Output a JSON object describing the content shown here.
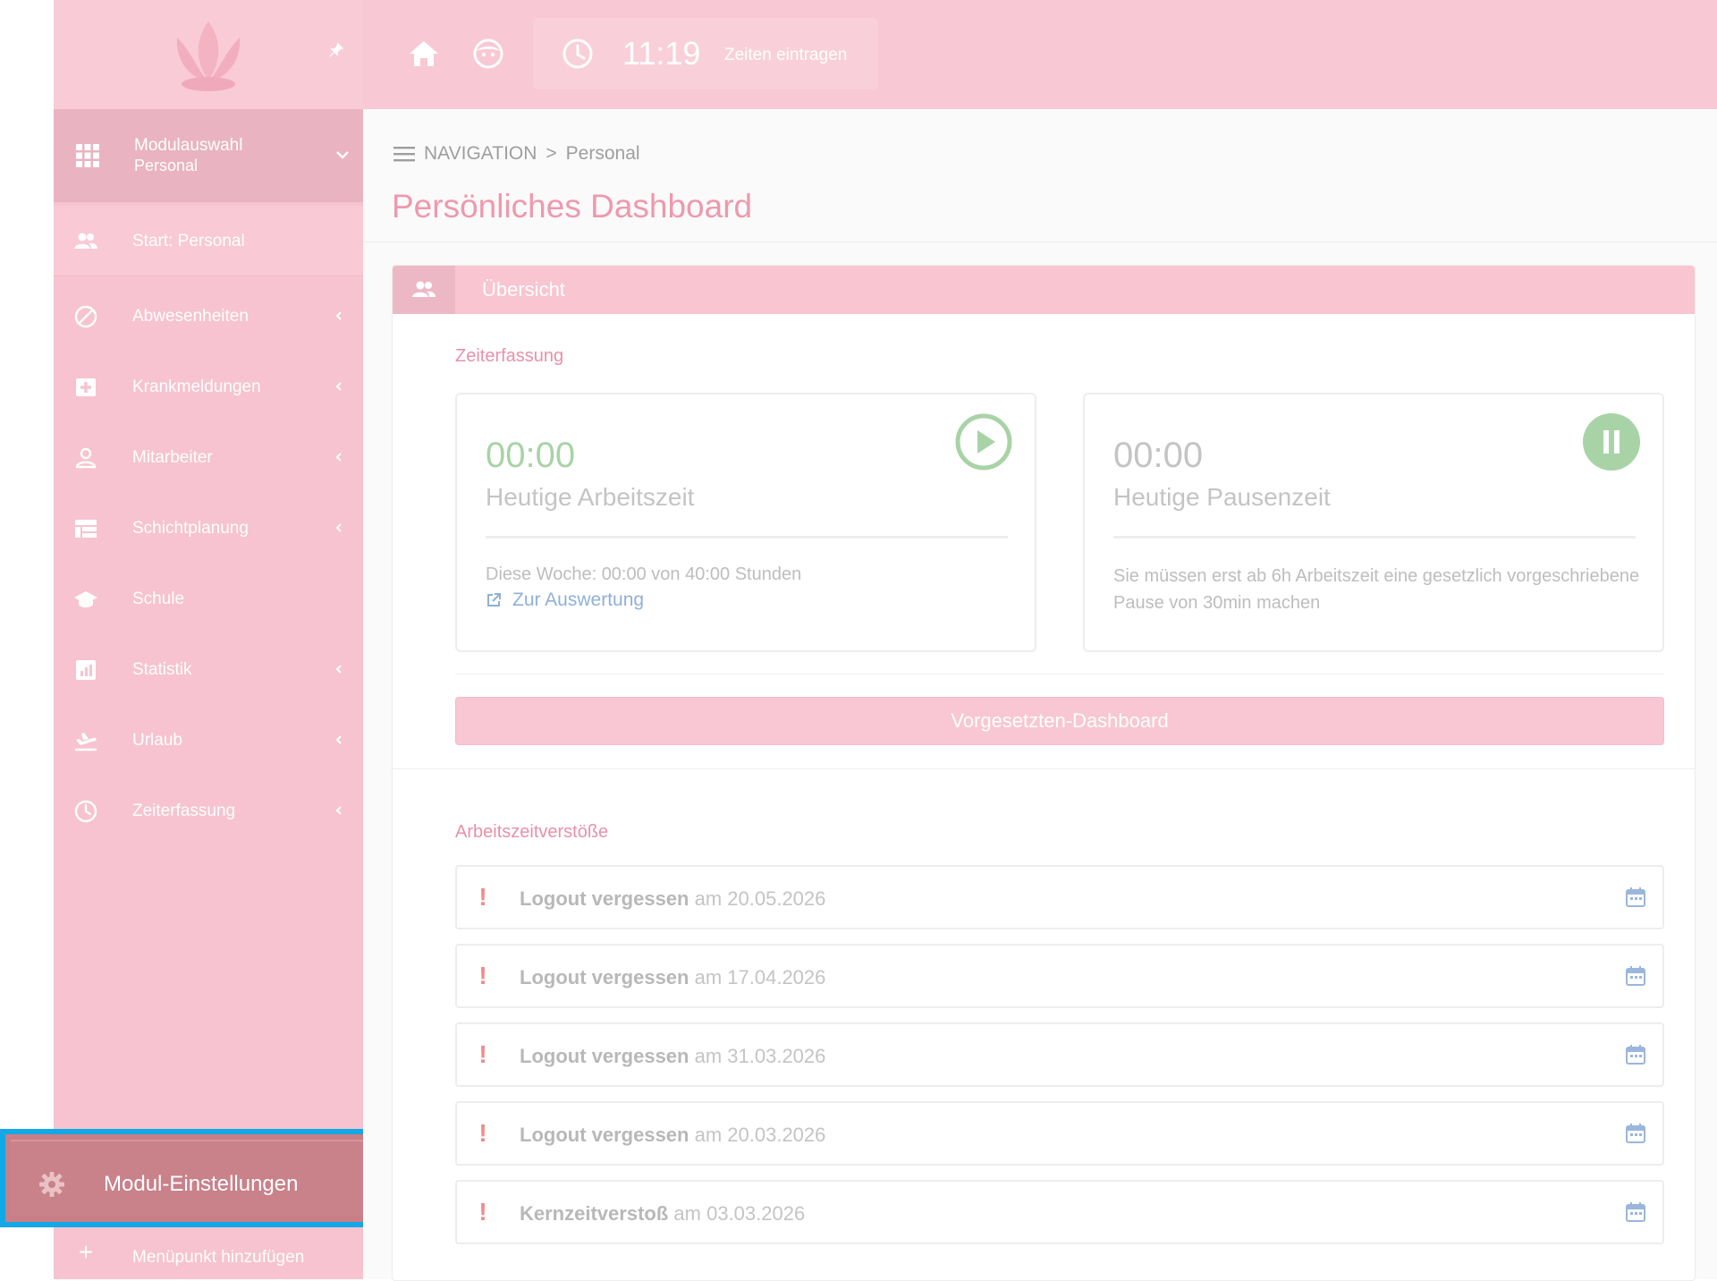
{
  "header": {
    "clock_time": "11:19",
    "clock_label": "Zeiten eintragen",
    "icons": [
      "lotus-logo",
      "pin-icon",
      "home-icon",
      "face-icon",
      "clock-icon"
    ]
  },
  "sidebar": {
    "module_title": "Modulauswahl",
    "module_sub": "Personal",
    "start_label": "Start: Personal",
    "items": [
      {
        "label": "Abwesenheiten",
        "icon": "ban-icon"
      },
      {
        "label": "Krankmeldungen",
        "icon": "medical-icon"
      },
      {
        "label": "Mitarbeiter",
        "icon": "person-icon"
      },
      {
        "label": "Schichtplanung",
        "icon": "table-icon"
      },
      {
        "label": "Schule",
        "icon": "school-icon"
      },
      {
        "label": "Statistik",
        "icon": "chart-icon"
      },
      {
        "label": "Urlaub",
        "icon": "plane-icon"
      },
      {
        "label": "Zeiterfassung",
        "icon": "clock-icon"
      }
    ],
    "settings_label": "Modul-Einstellungen",
    "add_label": "Menüpunkt hinzufügen"
  },
  "main": {
    "breadcrumb_root": "NAVIGATION",
    "breadcrumb_sep": ">",
    "breadcrumb_current": "Personal",
    "page_title": "Persönliches Dashboard",
    "panel_title": "Übersicht",
    "zeiterfassung_title": "Zeiterfassung",
    "work_card": {
      "time": "00:00",
      "caption": "Heutige Arbeitszeit",
      "week_text": "Diese Woche: 00:00 von 40:00 Stunden",
      "link": "Zur Auswertung"
    },
    "pause_card": {
      "time": "00:00",
      "caption": "Heutige Pausenzeit",
      "text": "Sie müssen erst ab 6h Arbeitszeit eine gesetzlich vorgeschriebene Pause von 30min machen"
    },
    "supervisor_button": "Vorgesetzten-Dashboard",
    "violations_title": "Arbeitszeitverstöße",
    "violations": [
      {
        "type": "Logout vergessen",
        "date_text": "am 20.05.2026"
      },
      {
        "type": "Logout vergessen",
        "date_text": "am 17.04.2026"
      },
      {
        "type": "Logout vergessen",
        "date_text": "am 31.03.2026"
      },
      {
        "type": "Logout vergessen",
        "date_text": "am 20.03.2026"
      },
      {
        "type": "Kernzeitverstoß",
        "date_text": "am 03.03.2026"
      }
    ]
  },
  "colors": {
    "header_bg": "#f8c8d4",
    "sidebar_bg": "#f7c3d0",
    "accent_pink": "#ee99ad",
    "highlight_border": "#12a8e6",
    "settings_bg": "#c9818a",
    "green": "#a8d3a6",
    "link_blue": "#8fb0d8",
    "warning_red": "#f08c8c"
  }
}
